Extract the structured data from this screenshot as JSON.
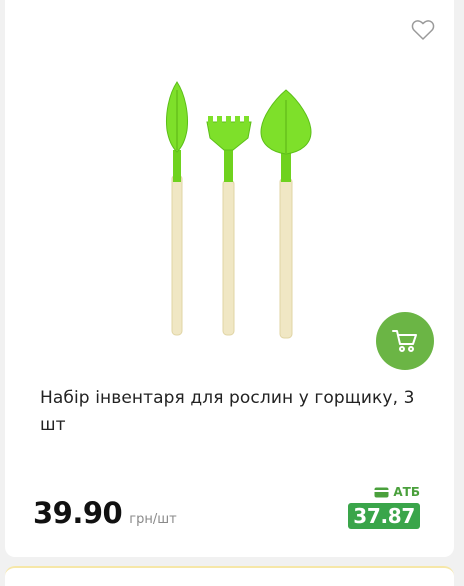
{
  "product": {
    "title": "Набір інвентаря для рослин у горщику, 3 шт",
    "image_alt": "product-image",
    "price": "39.90",
    "unit": "грн/шт",
    "atb_label": "АТБ",
    "atb_price": "37.87"
  },
  "icons": {
    "favorite": "heart-outline-icon",
    "cart": "cart-icon",
    "card": "card-icon"
  },
  "colors": {
    "accent_green": "#6bb545",
    "atb_green": "#3aa54a",
    "tool_green": "#7ee02a",
    "handle_wood": "#f0e7c4"
  }
}
